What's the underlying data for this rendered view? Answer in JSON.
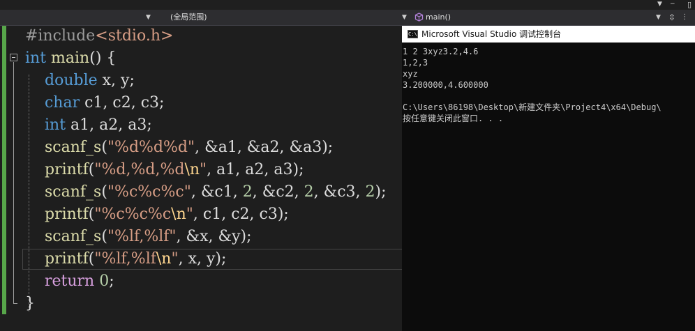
{
  "navbar": {
    "scope_label": "(全局范围)",
    "function_label": "main()"
  },
  "code_lines": [
    [
      "#include",
      "<stdio.h>"
    ],
    [
      "int",
      " ",
      "main",
      "()",
      " {"
    ],
    [
      "    ",
      "double",
      " x, y;"
    ],
    [
      "    ",
      "char",
      " c1, c2, c3;"
    ],
    [
      "    ",
      "int",
      " a1, a2, a3;"
    ],
    [
      "    ",
      "scanf_s",
      "(",
      "\"%d%d%d\"",
      ", ",
      "&a1, &a2, &a3",
      ");"
    ],
    [
      "    ",
      "printf",
      "(",
      "\"%d,%d,%d",
      "\\n",
      "\"",
      ", ",
      "a1, a2, a3",
      ");"
    ],
    [
      "    ",
      "scanf_s",
      "(",
      "\"%c%c%c\"",
      ", ",
      "&c1, ",
      "2",
      ", ",
      "&c2, ",
      "2",
      ", ",
      "&c3, ",
      "2",
      ");"
    ],
    [
      "    ",
      "printf",
      "(",
      "\"%c%c%c",
      "\\n",
      "\"",
      ", ",
      "c1, c2, c3",
      ");"
    ],
    [
      "    ",
      "scanf_s",
      "(",
      "\"%lf,%lf\"",
      ", ",
      "&x, &y",
      ");"
    ],
    [
      "    ",
      "printf",
      "(",
      "\"%lf,%lf",
      "\\n",
      "\"",
      ", ",
      "x, y",
      ");"
    ],
    [
      "    ",
      "return",
      " ",
      "0",
      ";"
    ],
    [
      "}"
    ]
  ],
  "console": {
    "title": "Microsoft Visual Studio 调试控制台",
    "icon_text": "C:\\",
    "lines": [
      "1 2 3xyz3.2,4.6",
      "1,2,3",
      "xyz",
      "3.200000,4.600000",
      "",
      "C:\\Users\\86198\\Desktop\\新建文件夹\\Project4\\x64\\Debug\\",
      "按任意键关闭此窗口. . ."
    ]
  },
  "colors": {
    "editor_bg": "#1e1e1e",
    "keyword": "#569cd6",
    "function": "#dcdcaa",
    "string": "#d69d85",
    "escape": "#ffd68f",
    "variable": "#9cdcfe",
    "number": "#b5cea8",
    "control_keyword": "#d8a0df",
    "preprocessor": "#9b9b9b",
    "change_bar": "#57a64a",
    "console_bg": "#0c0c0c"
  }
}
